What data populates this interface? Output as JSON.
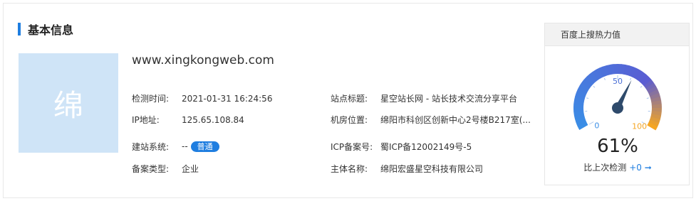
{
  "section": {
    "title": "基本信息"
  },
  "site": {
    "thumb_char": "绵",
    "domain": "www.xingkongweb.com"
  },
  "left_fields": [
    {
      "label": "检测时间:",
      "value": "2021-01-31 16:24:56"
    },
    {
      "label": "IP地址:",
      "value": "125.65.108.84"
    },
    {
      "label": "建站系统:",
      "value": "--",
      "badge": "普通"
    },
    {
      "label": "备案类型:",
      "value": "企业"
    }
  ],
  "right_fields": [
    {
      "label": "站点标题:",
      "value": "星空站长网 - 站长技术交流分享平台"
    },
    {
      "label": "机房位置:",
      "value": "绵阳市科创区创新中心2号楼B217室(..."
    },
    {
      "label": "ICP备案号:",
      "value": "蜀ICP备12002149号-5"
    },
    {
      "label": "主体名称:",
      "value": "绵阳宏盛星空科技有限公司"
    }
  ],
  "gauge": {
    "title": "百度上搜热力值",
    "value_percent": 61,
    "value_text": "61%",
    "scale_min_label": "0",
    "scale_mid_label": "50",
    "scale_max_label": "100",
    "compare_label": "比上次检测",
    "compare_delta": "+0 ➞",
    "colors": {
      "start": "#3a8ee6",
      "mid": "#4a6fd6",
      "end": "#f5a623",
      "needle": "#2e4a6b"
    }
  }
}
